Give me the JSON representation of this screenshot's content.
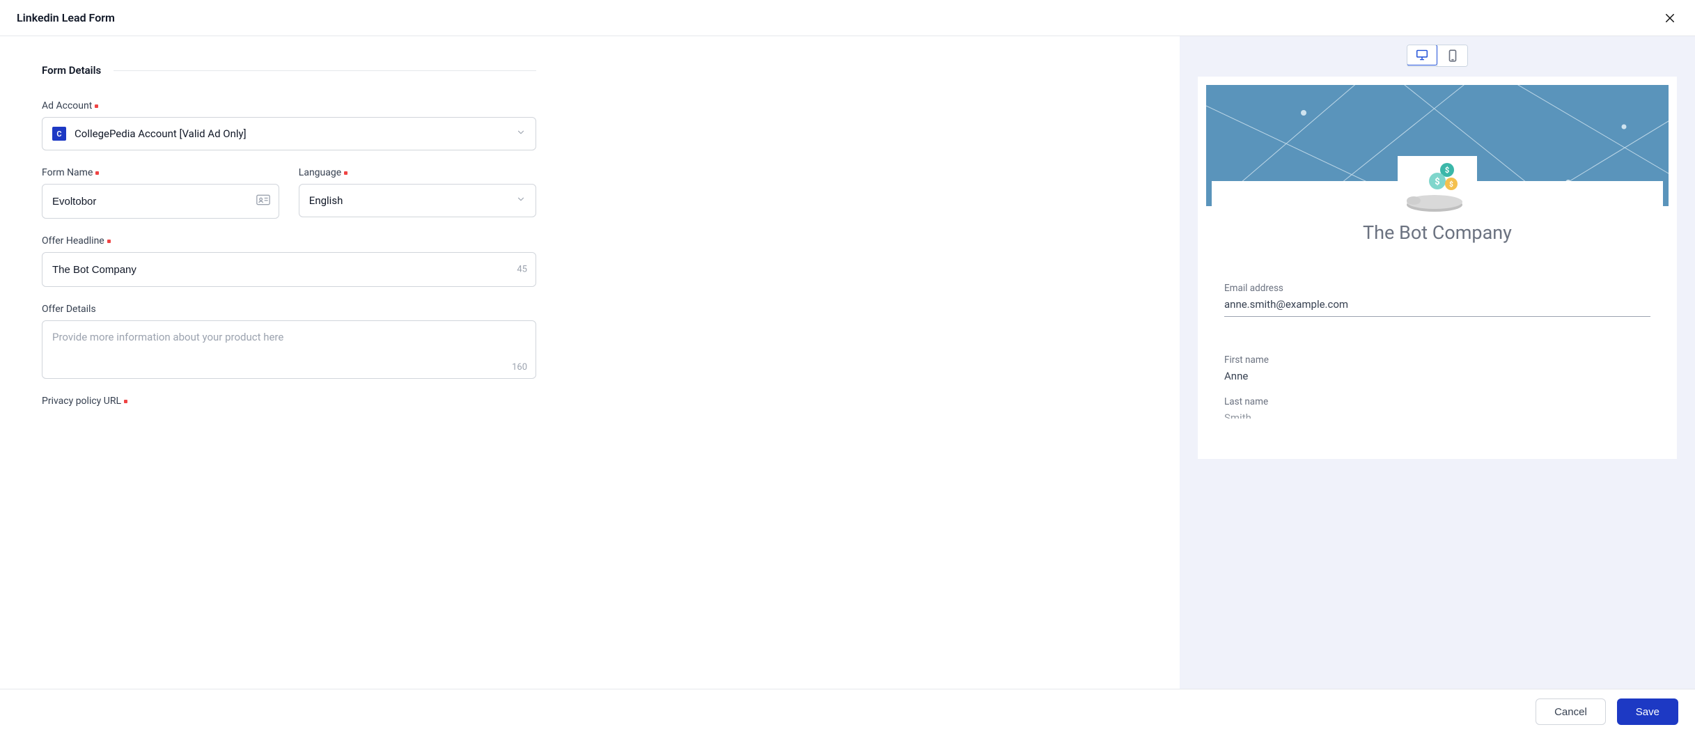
{
  "header": {
    "title": "Linkedin Lead Form"
  },
  "section": {
    "title": "Form Details"
  },
  "fields": {
    "ad_account": {
      "label": "Ad Account",
      "badge": "C",
      "value": "CollegePedia Account [Valid Ad Only]"
    },
    "form_name": {
      "label": "Form Name",
      "value": "Evoltobor"
    },
    "language": {
      "label": "Language",
      "value": "English"
    },
    "offer_headline": {
      "label": "Offer Headline",
      "value": "The Bot Company",
      "count": "45"
    },
    "offer_details": {
      "label": "Offer Details",
      "placeholder": "Provide more information about your product here",
      "count": "160"
    },
    "privacy_url": {
      "label": "Privacy policy URL"
    }
  },
  "preview": {
    "company": "The Bot Company",
    "email_label": "Email address",
    "email_value": "anne.smith@example.com",
    "first_name_label": "First name",
    "first_name_value": "Anne",
    "last_name_label": "Last name",
    "last_name_value": "Smith"
  },
  "footer": {
    "cancel": "Cancel",
    "save": "Save"
  }
}
